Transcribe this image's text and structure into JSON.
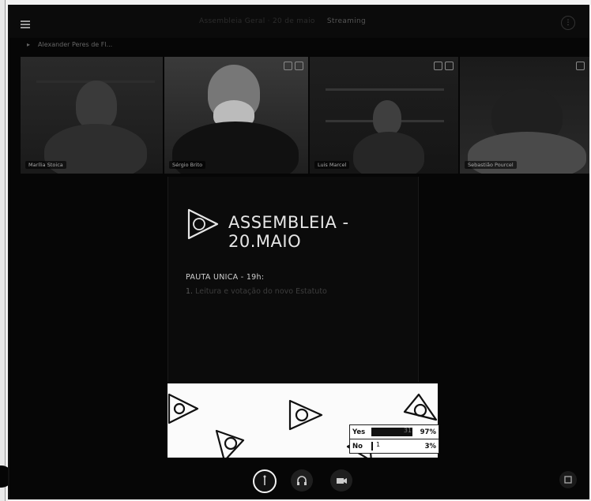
{
  "topbar": {
    "title": "Assembleia Geral · 20 de maio",
    "live_label": "Streaming"
  },
  "user": {
    "name": "Alexander Peres de Fl..."
  },
  "participants": [
    {
      "name": "Marília Stoica"
    },
    {
      "name": "Sérgio Brito"
    },
    {
      "name": "Luis Marcel"
    },
    {
      "name": "Sebastião Pourcel"
    }
  ],
  "slide": {
    "heading": "ASSEMBLEIA - 20.MAIO",
    "pauta": "PAUTA UNICA - 19h:",
    "item_number": "1.",
    "item_text": "Leitura e votação do novo Estatuto"
  },
  "poll": {
    "yes_label": "Yes",
    "yes_count": "31",
    "yes_pct": "97%",
    "no_label": "No",
    "no_count": "1",
    "no_pct": "3%",
    "yes_fraction": 0.97,
    "no_fraction": 0.03
  },
  "controls": {
    "raise_hand_icon": "hand-icon",
    "audio_icon": "headphones-icon",
    "video_icon": "camera-icon",
    "layout_icon": "window-icon"
  },
  "colors": {
    "background": "#060606",
    "slide_heading": "#e6e6e6",
    "poll_fill": "#111111"
  }
}
